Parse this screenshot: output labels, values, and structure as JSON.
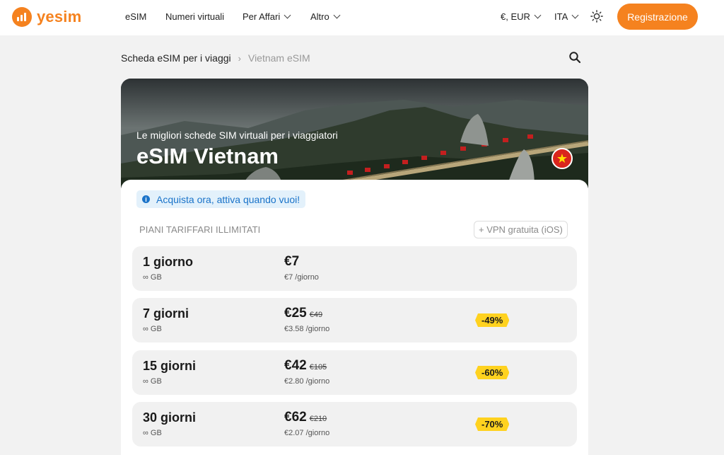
{
  "brand": {
    "name": "yesim",
    "accent": "#f5821f"
  },
  "nav": {
    "items": [
      {
        "label": "eSIM"
      },
      {
        "label": "Numeri virtuali"
      },
      {
        "label": "Per Affari"
      },
      {
        "label": "Altro"
      }
    ],
    "currency": "€, EUR",
    "language": "ITA",
    "register_label": "Registrazione"
  },
  "breadcrumb": {
    "parent": "Scheda eSIM per i viaggi",
    "current": "Vietnam eSIM"
  },
  "hero": {
    "subtitle": "Le migliori schede SIM virtuali per i viaggiatori",
    "title": "eSIM Vietnam",
    "flag": "★"
  },
  "info": {
    "icon": "i",
    "text": "Acquista ora, attiva quando vuoi!"
  },
  "plans_section": {
    "heading": "PIANI TARIFFARI ILLIMITATI",
    "vpn_label": "+ VPN gratuita (iOS)"
  },
  "plans": [
    {
      "name": "1 giorno",
      "data": "∞ GB",
      "price": "€7",
      "old_price": "",
      "per_day": "€7 /giorno",
      "discount": ""
    },
    {
      "name": "7 giorni",
      "data": "∞ GB",
      "price": "€25",
      "old_price": "€49",
      "per_day": "€3.58 /giorno",
      "discount": "-49%"
    },
    {
      "name": "15 giorni",
      "data": "∞ GB",
      "price": "€42",
      "old_price": "€105",
      "per_day": "€2.80 /giorno",
      "discount": "-60%"
    },
    {
      "name": "30 giorni",
      "data": "∞ GB",
      "price": "€62",
      "old_price": "€210",
      "per_day": "€2.07 /giorno",
      "discount": "-70%"
    }
  ],
  "icons": {
    "theme": "sun-icon",
    "search": "search-icon",
    "info": "info-icon"
  }
}
